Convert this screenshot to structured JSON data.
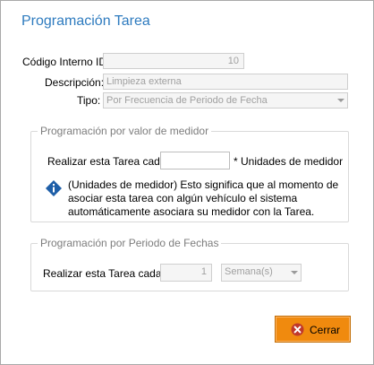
{
  "window": {
    "title": "Programación Tarea"
  },
  "form": {
    "codigo_label": "Código Interno ID:",
    "codigo_value": "10",
    "descripcion_label": "Descripción:",
    "descripcion_value": "Limpieza externa",
    "tipo_label": "Tipo:",
    "tipo_value": "Por Frecuencia de Periodo de Fecha"
  },
  "medidor_group": {
    "title": "Programación por valor de medidor",
    "realizar_label": "Realizar esta Tarea cada:",
    "realizar_value": "",
    "unidades_label": "* Unidades de medidor",
    "info_text": "(Unidades de medidor) Esto significa que al momento de asociar esta tarea con algún vehículo el sistema automáticamente asociara su medidor con la Tarea."
  },
  "fechas_group": {
    "title": "Programación por Periodo de Fechas",
    "realizar_label": "Realizar esta Tarea cada :",
    "cantidad_value": "1",
    "unidad_value": "Semana(s)"
  },
  "buttons": {
    "cerrar_label": "Cerrar"
  },
  "colors": {
    "title": "#2e7bbf",
    "button_orange": "#f08a0e",
    "close_icon": "#c0392b",
    "info_icon": "#1f5fa8"
  },
  "icons": {
    "info": "info-diamond-icon",
    "close": "close-circle-icon"
  }
}
